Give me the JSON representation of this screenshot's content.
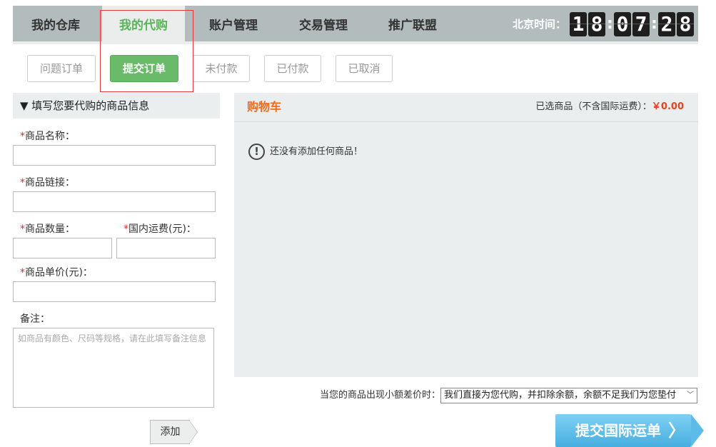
{
  "nav": {
    "tabs": [
      {
        "label": "我的仓库"
      },
      {
        "label": "我的代购"
      },
      {
        "label": "账户管理"
      },
      {
        "label": "交易管理"
      },
      {
        "label": "推广联盟"
      }
    ],
    "active_index": 1,
    "clock_label": "北京时间：",
    "clock": {
      "h1": "1",
      "h2": "8",
      "m1": "0",
      "m2": "7",
      "s1": "2",
      "s2": "8"
    }
  },
  "subtabs": [
    {
      "label": "问题订单"
    },
    {
      "label": "提交订单"
    },
    {
      "label": "未付款"
    },
    {
      "label": "已付款"
    },
    {
      "label": "已取消"
    }
  ],
  "form": {
    "header": "▼ 填写您要代购的商品信息",
    "required_mark": "*",
    "name_label": "商品名称：",
    "link_label": "商品链接：",
    "qty_label": "商品数量：",
    "shipping_label": "国内运费(元)：",
    "price_label": "商品单价(元)：",
    "note_label": "备注：",
    "note_placeholder": "如商品有颜色、尺码等规格，请在此填写备注信息",
    "add_button": "添加"
  },
  "cart": {
    "title": "购物车",
    "summary_label": "已选商品（不含国际运费）：",
    "summary_amount": "￥0.00",
    "empty_icon": "!",
    "empty_text": "还没有添加任何商品！"
  },
  "bottom": {
    "diff_label": "当您的商品出现小额差价时：",
    "diff_selected": "我们直接为您代购，并扣除余额，余额不足我们为您垫付",
    "submit_button": "提交国际运单",
    "submit_arrow": "〉"
  },
  "colors": {
    "active_tab_text": "#5bb45b",
    "active_subtab_bg": "#69bb69",
    "cart_title": "#ee6b1f",
    "price": "#e5441f",
    "submit_bg": "#47aee0"
  }
}
